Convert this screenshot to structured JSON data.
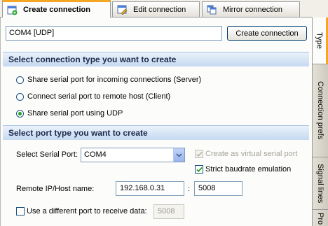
{
  "tabs": [
    {
      "label": "Create connection",
      "icon": "create-connection-icon"
    },
    {
      "label": "Edit connection",
      "icon": "edit-connection-icon"
    },
    {
      "label": "Mirror connection",
      "icon": "mirror-connection-icon"
    }
  ],
  "connection": {
    "name_value": "COM4 [UDP]",
    "create_button": "Create connection"
  },
  "type_section": {
    "title": "Select connection type you want to create",
    "options": [
      {
        "label": "Share serial port for incoming connections (Server)",
        "selected": false
      },
      {
        "label": "Connect serial port to remote host (Client)",
        "selected": false
      },
      {
        "label": "Share serial port using UDP",
        "selected": true
      }
    ]
  },
  "port_section": {
    "title": "Select port type you want to create",
    "serial_port_label": "Select Serial Port:",
    "serial_port_value": "COM4",
    "virtual_port_label": "Create as virtual serial port",
    "virtual_port_checked": true,
    "virtual_port_enabled": false,
    "strict_baud_label": "Strict baudrate emulation",
    "strict_baud_checked": true,
    "remote_label": "Remote IP/Host name:",
    "remote_ip": "192.168.0.31",
    "separator": ":",
    "remote_port": "5008",
    "diff_port_label": "Use a different port to receive data:",
    "diff_port_checked": false,
    "diff_port_value": "5008"
  },
  "side_tabs": [
    "Type",
    "Connection prefs",
    "Signal lines",
    "Pro"
  ],
  "colors": {
    "accent": "#f5a623",
    "section_text": "#1b2a4a",
    "check": "#21a121"
  }
}
